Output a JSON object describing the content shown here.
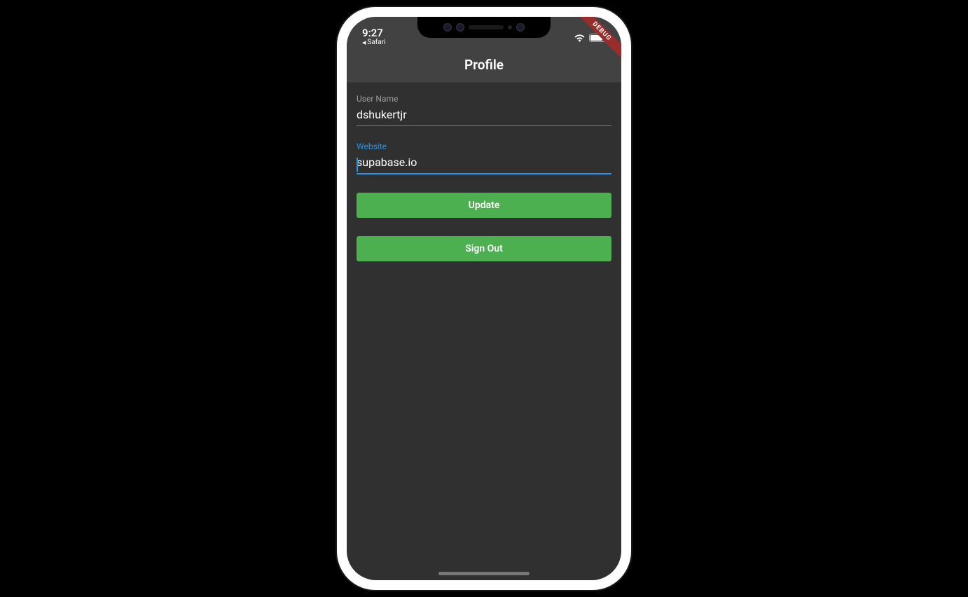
{
  "status_bar": {
    "time": "9:27",
    "back_app": "Safari"
  },
  "debug_banner": "DEBUG",
  "app_bar": {
    "title": "Profile"
  },
  "form": {
    "username": {
      "label": "User Name",
      "value": "dshukertjr"
    },
    "website": {
      "label": "Website",
      "value": "supabase.io"
    }
  },
  "buttons": {
    "update": "Update",
    "sign_out": "Sign Out"
  }
}
